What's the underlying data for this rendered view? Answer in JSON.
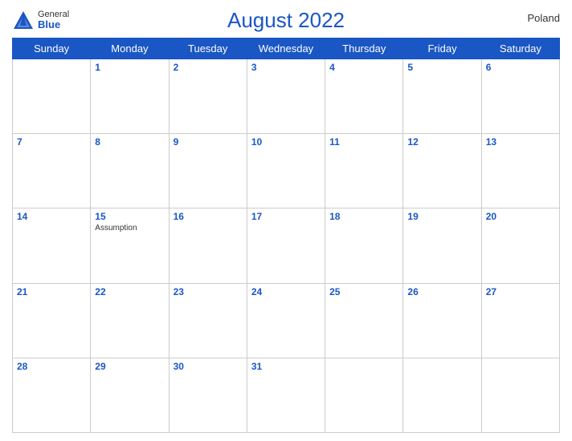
{
  "header": {
    "title": "August 2022",
    "country": "Poland",
    "logo": {
      "general": "General",
      "blue": "Blue"
    }
  },
  "weekdays": [
    "Sunday",
    "Monday",
    "Tuesday",
    "Wednesday",
    "Thursday",
    "Friday",
    "Saturday"
  ],
  "weeks": [
    [
      {
        "day": "",
        "empty": true
      },
      {
        "day": "1"
      },
      {
        "day": "2"
      },
      {
        "day": "3"
      },
      {
        "day": "4"
      },
      {
        "day": "5"
      },
      {
        "day": "6"
      }
    ],
    [
      {
        "day": "7"
      },
      {
        "day": "8"
      },
      {
        "day": "9"
      },
      {
        "day": "10"
      },
      {
        "day": "11"
      },
      {
        "day": "12"
      },
      {
        "day": "13"
      }
    ],
    [
      {
        "day": "14"
      },
      {
        "day": "15",
        "event": "Assumption"
      },
      {
        "day": "16"
      },
      {
        "day": "17"
      },
      {
        "day": "18"
      },
      {
        "day": "19"
      },
      {
        "day": "20"
      }
    ],
    [
      {
        "day": "21"
      },
      {
        "day": "22"
      },
      {
        "day": "23"
      },
      {
        "day": "24"
      },
      {
        "day": "25"
      },
      {
        "day": "26"
      },
      {
        "day": "27"
      }
    ],
    [
      {
        "day": "28"
      },
      {
        "day": "29"
      },
      {
        "day": "30"
      },
      {
        "day": "31"
      },
      {
        "day": "",
        "empty": true
      },
      {
        "day": "",
        "empty": true
      },
      {
        "day": "",
        "empty": true
      }
    ]
  ]
}
